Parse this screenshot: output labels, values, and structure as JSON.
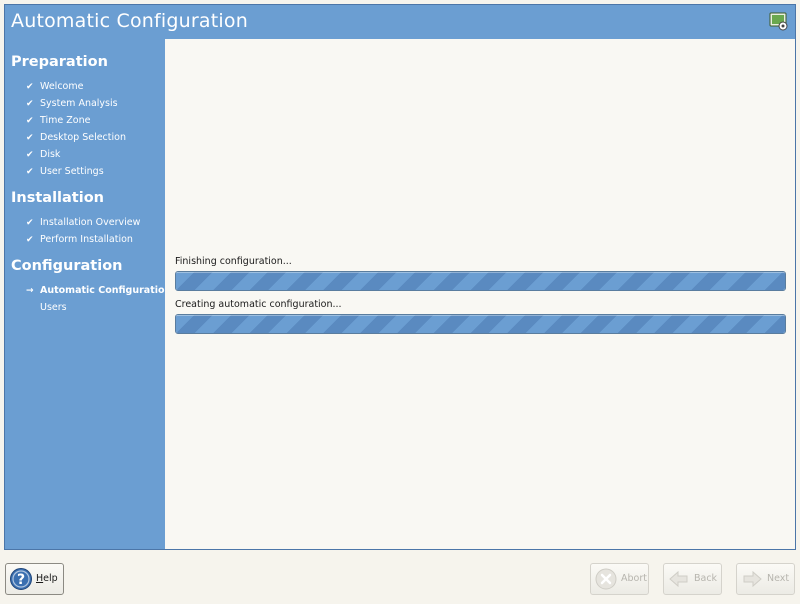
{
  "window": {
    "title": "Automatic Configuration"
  },
  "sidebar": {
    "sections": [
      {
        "title": "Preparation",
        "steps": [
          {
            "label": "Welcome",
            "status": "done",
            "mark": "✔"
          },
          {
            "label": "System Analysis",
            "status": "done",
            "mark": "✔"
          },
          {
            "label": "Time Zone",
            "status": "done",
            "mark": "✔"
          },
          {
            "label": "Desktop Selection",
            "status": "done",
            "mark": "✔"
          },
          {
            "label": "Disk",
            "status": "done",
            "mark": "✔"
          },
          {
            "label": "User Settings",
            "status": "done",
            "mark": "✔"
          }
        ]
      },
      {
        "title": "Installation",
        "steps": [
          {
            "label": "Installation Overview",
            "status": "done",
            "mark": "✔"
          },
          {
            "label": "Perform Installation",
            "status": "done",
            "mark": "✔"
          }
        ]
      },
      {
        "title": "Configuration",
        "steps": [
          {
            "label": "Automatic Configuration",
            "status": "current",
            "mark": "→"
          },
          {
            "label": "Users",
            "status": "pending",
            "mark": ""
          }
        ]
      }
    ]
  },
  "main": {
    "progress": [
      {
        "label": "Finishing configuration...",
        "value": 1.0
      },
      {
        "label": "Creating automatic configuration...",
        "value": 1.0
      }
    ]
  },
  "buttons": {
    "help": {
      "label": "Help",
      "accel": "H",
      "rest": "elp",
      "enabled": true
    },
    "abort": {
      "label": "Abort",
      "enabled": false
    },
    "back": {
      "label": "Back",
      "enabled": false
    },
    "next": {
      "label": "Next",
      "enabled": false
    }
  },
  "colors": {
    "accent": "#6b9ed2",
    "background": "#f9f8f3",
    "progress_stripe": "#5a8ac0"
  },
  "icons": {
    "title": "config-monitor-icon",
    "help": "help-question-icon",
    "abort": "abort-x-icon",
    "back": "back-arrow-icon",
    "next": "next-arrow-icon"
  }
}
